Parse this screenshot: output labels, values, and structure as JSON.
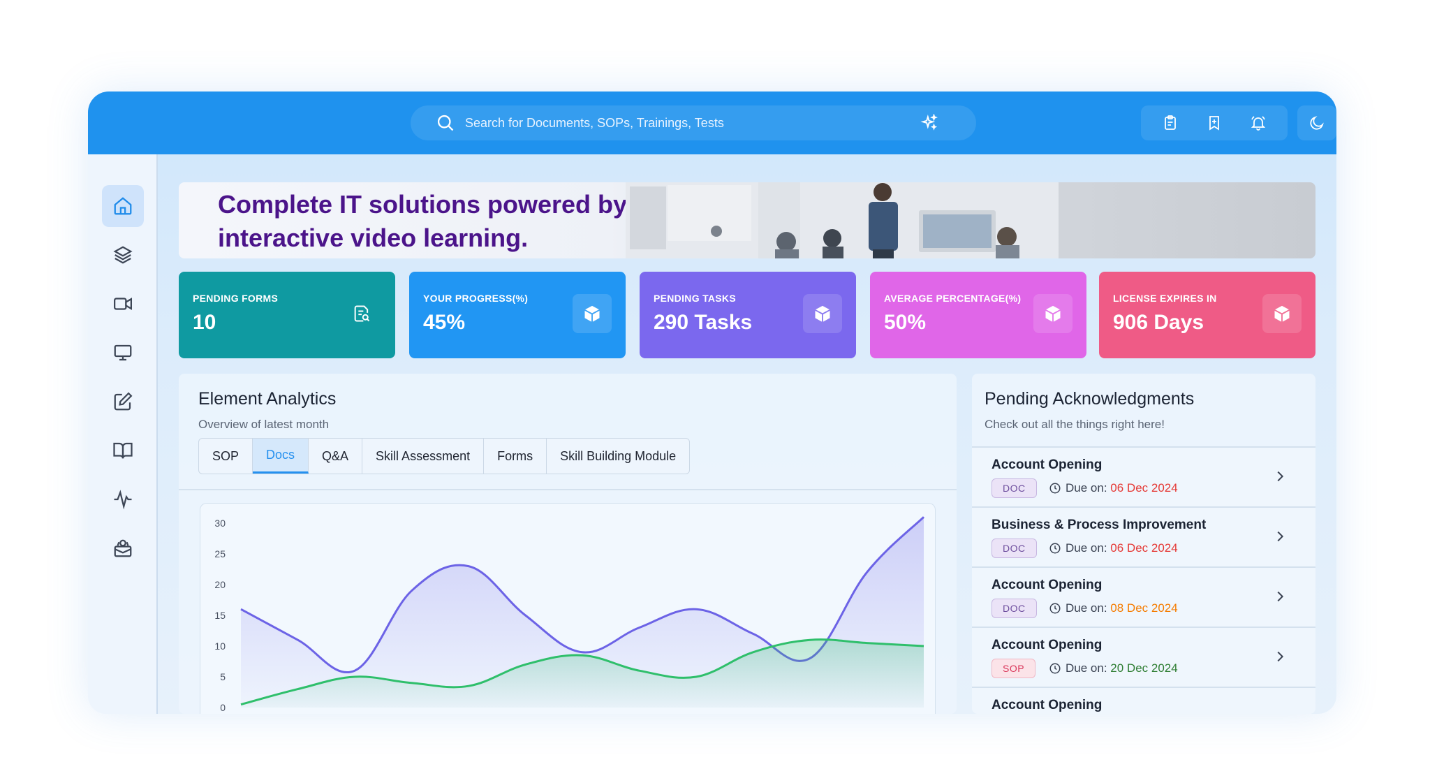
{
  "header": {
    "search_placeholder": "Search for Documents, SOPs, Trainings, Tests"
  },
  "banner": {
    "title": "Complete IT solutions powered by interactive video learning."
  },
  "stats": [
    {
      "label": "PENDING FORMS",
      "value": "10",
      "color": "#0f9aa1",
      "icon": "form-search-icon"
    },
    {
      "label": "YOUR PROGRESS(%)",
      "value": "45%",
      "color": "#2196f3",
      "icon": "cube-icon"
    },
    {
      "label": "PENDING TASKS",
      "value": "290 Tasks",
      "color": "#7b68ee",
      "icon": "cube-icon"
    },
    {
      "label": "AVERAGE PERCENTAGE(%)",
      "value": "50%",
      "color": "#e066e8",
      "icon": "cube-icon"
    },
    {
      "label": "LICENSE EXPIRES IN",
      "value": "906 Days",
      "color": "#ef5b86",
      "icon": "cube-icon"
    }
  ],
  "analytics": {
    "title": "Element Analytics",
    "subtitle": "Overview of latest month",
    "tabs": [
      "SOP",
      "Docs",
      "Q&A",
      "Skill Assessment",
      "Forms",
      "Skill Building Module"
    ],
    "active_tab": "Docs"
  },
  "chart_data": {
    "type": "area",
    "yticks": [
      "30",
      "25",
      "20",
      "15",
      "10",
      "5",
      "0"
    ],
    "ylim": [
      0,
      30
    ],
    "series": [
      {
        "color": "#6c63e6",
        "values": [
          16,
          11,
          6,
          19,
          23,
          15,
          9,
          13,
          16,
          12,
          8,
          22,
          31
        ]
      },
      {
        "color": "#2fbf6b",
        "values": [
          0.5,
          3,
          5,
          4,
          3.5,
          7,
          8.5,
          6,
          5,
          9,
          11,
          10.5,
          10
        ]
      }
    ]
  },
  "acknowledgments": {
    "title": "Pending Acknowledgments",
    "subtitle": "Check out all the things right here!",
    "due_label": "Due on:",
    "items": [
      {
        "title": "Account Opening",
        "badge": "DOC",
        "due": "06 Dec 2024",
        "due_color": "#e53935"
      },
      {
        "title": "Business & Process Improvement",
        "badge": "DOC",
        "due": "06 Dec 2024",
        "due_color": "#e53935"
      },
      {
        "title": "Account Opening",
        "badge": "DOC",
        "due": "08 Dec 2024",
        "due_color": "#f57c00"
      },
      {
        "title": "Account Opening",
        "badge": "SOP",
        "due": "20 Dec 2024",
        "due_color": "#2e7d32"
      },
      {
        "title": "Account Opening",
        "badge": "",
        "due": "",
        "due_color": "#2e7d32"
      }
    ]
  },
  "sidebar": {
    "items": [
      "home-icon",
      "layers-icon",
      "video-icon",
      "monitor-icon",
      "edit-icon",
      "book-icon",
      "activity-icon",
      "badge-icon"
    ]
  }
}
